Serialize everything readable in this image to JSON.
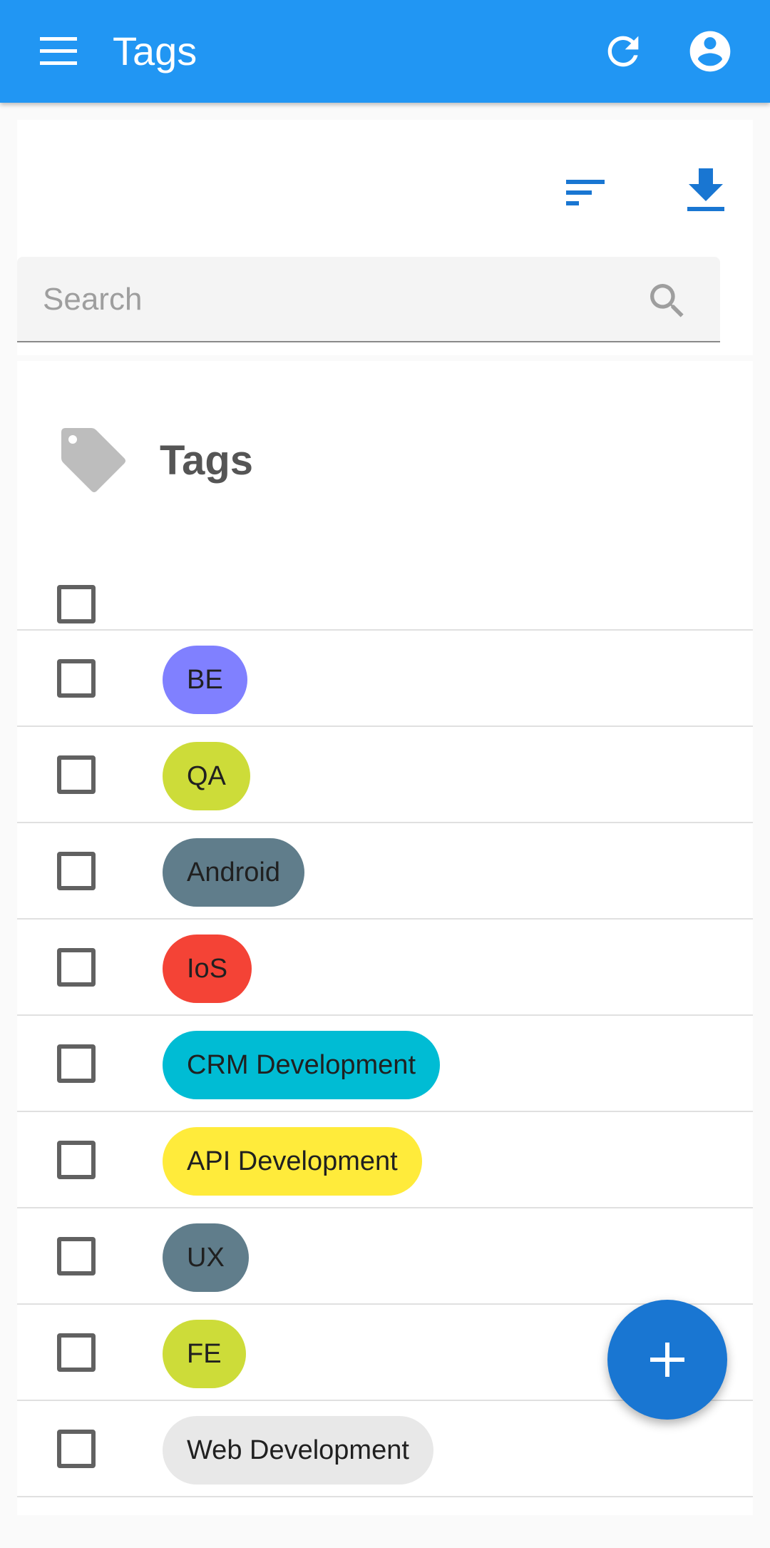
{
  "appbar": {
    "title": "Tags",
    "menu_icon": "menu-icon",
    "refresh_icon": "refresh-icon",
    "account_icon": "account-circle-icon",
    "color": "#2196f3"
  },
  "toolbar": {
    "sort_icon": "sort-icon",
    "download_icon": "download-icon",
    "icon_color": "#1976d2"
  },
  "search": {
    "placeholder": "Search",
    "value": "",
    "icon": "search-icon"
  },
  "list": {
    "title": "Tags",
    "title_icon": "tag-icon",
    "select_all_checked": false,
    "tags": [
      {
        "label": "BE",
        "color": "#8080ff",
        "checked": false
      },
      {
        "label": "QA",
        "color": "#cddc39",
        "checked": false
      },
      {
        "label": "Android",
        "color": "#607d8b",
        "checked": false
      },
      {
        "label": "IoS",
        "color": "#f44336",
        "checked": false
      },
      {
        "label": "CRM Development",
        "color": "#00bcd4",
        "checked": false
      },
      {
        "label": "API Development",
        "color": "#ffeb3b",
        "checked": false
      },
      {
        "label": "UX",
        "color": "#607d8b",
        "checked": false
      },
      {
        "label": "FE",
        "color": "#cddc39",
        "checked": false
      },
      {
        "label": "Web Development",
        "color": "#e8e8e8",
        "checked": false
      }
    ]
  },
  "fab": {
    "icon": "plus-icon",
    "color": "#1976d2"
  }
}
